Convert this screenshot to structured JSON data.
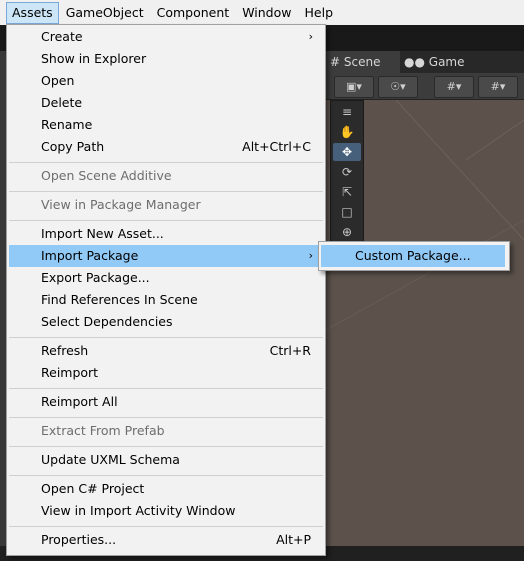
{
  "menubar": {
    "items": [
      "Assets",
      "GameObject",
      "Component",
      "Window",
      "Help"
    ]
  },
  "tabs": {
    "scene": "Scene",
    "game": "Game"
  },
  "assets_menu": {
    "items": [
      {
        "label": "Create",
        "submenu": true
      },
      {
        "label": "Show in Explorer"
      },
      {
        "label": "Open"
      },
      {
        "label": "Delete"
      },
      {
        "label": "Rename"
      },
      {
        "label": "Copy Path",
        "shortcut": "Alt+Ctrl+C"
      },
      {
        "label": "Open Scene Additive",
        "disabled": true
      },
      {
        "label": "View in Package Manager",
        "disabled": true
      },
      {
        "label": "Import New Asset..."
      },
      {
        "label": "Import Package",
        "submenu": true,
        "highlight": true
      },
      {
        "label": "Export Package..."
      },
      {
        "label": "Find References In Scene"
      },
      {
        "label": "Select Dependencies"
      },
      {
        "label": "Refresh",
        "shortcut": "Ctrl+R"
      },
      {
        "label": "Reimport"
      },
      {
        "label": "Reimport All"
      },
      {
        "label": "Extract From Prefab",
        "disabled": true
      },
      {
        "label": "Update UXML Schema"
      },
      {
        "label": "Open C# Project"
      },
      {
        "label": "View in Import Activity Window"
      },
      {
        "label": "Properties...",
        "shortcut": "Alt+P"
      }
    ]
  },
  "submenu": {
    "items": [
      {
        "label": "Custom Package..."
      }
    ]
  },
  "icons": {
    "submenu_arrow": "chevron-right-icon",
    "scene_tab": "hash-icon",
    "game_tab": "gamepad-icon"
  }
}
